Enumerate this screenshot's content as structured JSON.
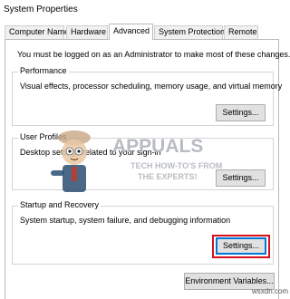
{
  "window": {
    "title": "System Properties"
  },
  "tabs": [
    {
      "label": "Computer Name",
      "active": false
    },
    {
      "label": "Hardware",
      "active": false
    },
    {
      "label": "Advanced",
      "active": true
    },
    {
      "label": "System Protection",
      "active": false
    },
    {
      "label": "Remote",
      "active": false
    }
  ],
  "notice": "You must be logged on as an Administrator to make most of these changes.",
  "groups": {
    "performance": {
      "title": "Performance",
      "description": "Visual effects, processor scheduling, memory usage, and virtual memory",
      "button": "Settings..."
    },
    "user_profiles": {
      "title": "User Profiles",
      "description": "Desktop settings related to your sign-in",
      "button": "Settings..."
    },
    "startup_recovery": {
      "title": "Startup and Recovery",
      "description": "System startup, system failure, and debugging information",
      "button": "Settings..."
    }
  },
  "environment_button": "Environment Variables...",
  "watermark": {
    "brand": "APPUALS",
    "tagline_1": "TECH HOW-TO'S FROM",
    "tagline_2": "THE EXPERTS!"
  },
  "source_mark": "wsxdn.com",
  "colors": {
    "highlight": "#d8101a",
    "focus": "#0078d7",
    "button": "#e1e1e1"
  }
}
